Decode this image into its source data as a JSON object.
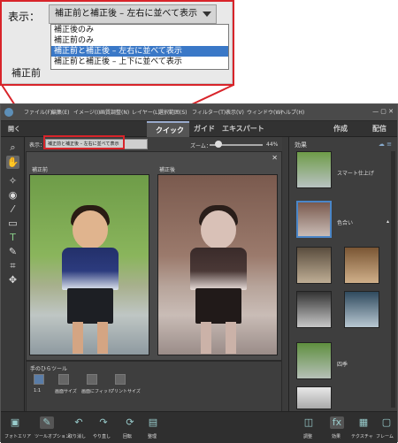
{
  "inset": {
    "view_label": "表示：",
    "selected_view": "補正前と補正後 – 左右に並べて表示",
    "options": [
      "補正後のみ",
      "補正前のみ",
      "補正前と補正後 – 左右に並べて表示",
      "補正前と補正後 – 上下に並べて表示"
    ],
    "before_label": "補正前"
  },
  "app": {
    "menu": [
      "ファイル(F)",
      "編集(E)",
      "イメージ(I)",
      "画質調整(N)",
      "レイヤー(L)",
      "選択範囲(S)",
      "フィルター(T)",
      "表示(V)",
      "ウィンドウ(W)",
      "ヘルプ(H)"
    ],
    "open_label": "開く",
    "modes": {
      "quick": "クイック",
      "guide": "ガイド",
      "expert": "エキスパート"
    },
    "create_label": "作成",
    "share_label": "配信",
    "view_label": "表示：",
    "view_select": "補正前と補正後 – 左右に並べて表示",
    "zoom_label": "ズーム：",
    "zoom_value": "44%",
    "before_label": "補正前",
    "after_label": "補正後",
    "hand_tool": {
      "title": "手のひらツール",
      "buttons": [
        "1:1",
        "画面サイズ",
        "画面にフィット",
        "プリントサイズ"
      ]
    },
    "effects": {
      "title": "効果",
      "items": [
        "スマート仕上げ",
        "色合い",
        "四季"
      ]
    },
    "bottom": [
      "フォトエリア",
      "ツールオプション",
      "取り消し",
      "やり直し",
      "回転",
      "整理",
      "調整",
      "効果",
      "テクスチャ",
      "フレーム"
    ]
  },
  "colors": {
    "highlight": "#d8242a",
    "selection": "#3a78c7",
    "accent": "#5d8fb8"
  }
}
